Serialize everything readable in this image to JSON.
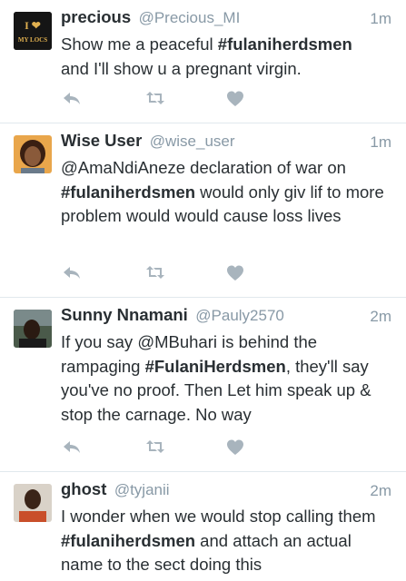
{
  "feed": {
    "tweets": [
      {
        "name": "precious",
        "handle": "@Precious_MI",
        "time": "1m",
        "text_before": "Show me a peaceful ",
        "hashtag": "#fulaniherdsmen",
        "text_after": "and I'll show u a pregnant virgin.",
        "avatar_text_top": "I ❤",
        "avatar_text_bottom": "MY LOCS",
        "avatar_bg": "#1a1a1a",
        "avatar_fg": "#e0b050"
      },
      {
        "name": "Wise User",
        "handle": "@wise_user",
        "time": "1m",
        "text_before": "@AmaNdiAneze declaration of war on ",
        "hashtag": "#fulaniherdsmen",
        "text_after": " would only giv lif to more problem would would cause loss lives",
        "avatar_bg": "#e8a84a"
      },
      {
        "name": "Sunny Nnamani",
        "handle": "@Pauly2570",
        "time": "2m",
        "text_before": "If you say @MBuhari is behind the rampaging ",
        "hashtag": "#FulaniHerdsmen",
        "text_after": ", they'll say you've no proof. Then Let him speak up & stop the carnage. No way",
        "avatar_bg": "#3a4a3a"
      },
      {
        "name": "ghost",
        "handle": "@tyjanii",
        "time": "2m",
        "text_before": "I wonder when we would stop calling them ",
        "hashtag": "#fulaniherdsmen",
        "text_after": " and attach an actual name to the sect doing this",
        "avatar_bg": "#c94f2a"
      }
    ]
  },
  "colors": {
    "text": "#292f33",
    "meta": "#8899a6",
    "icon": "#a8b4bd",
    "divider": "#e1e8ed"
  },
  "icons": [
    "reply-icon",
    "retweet-icon",
    "like-icon"
  ]
}
